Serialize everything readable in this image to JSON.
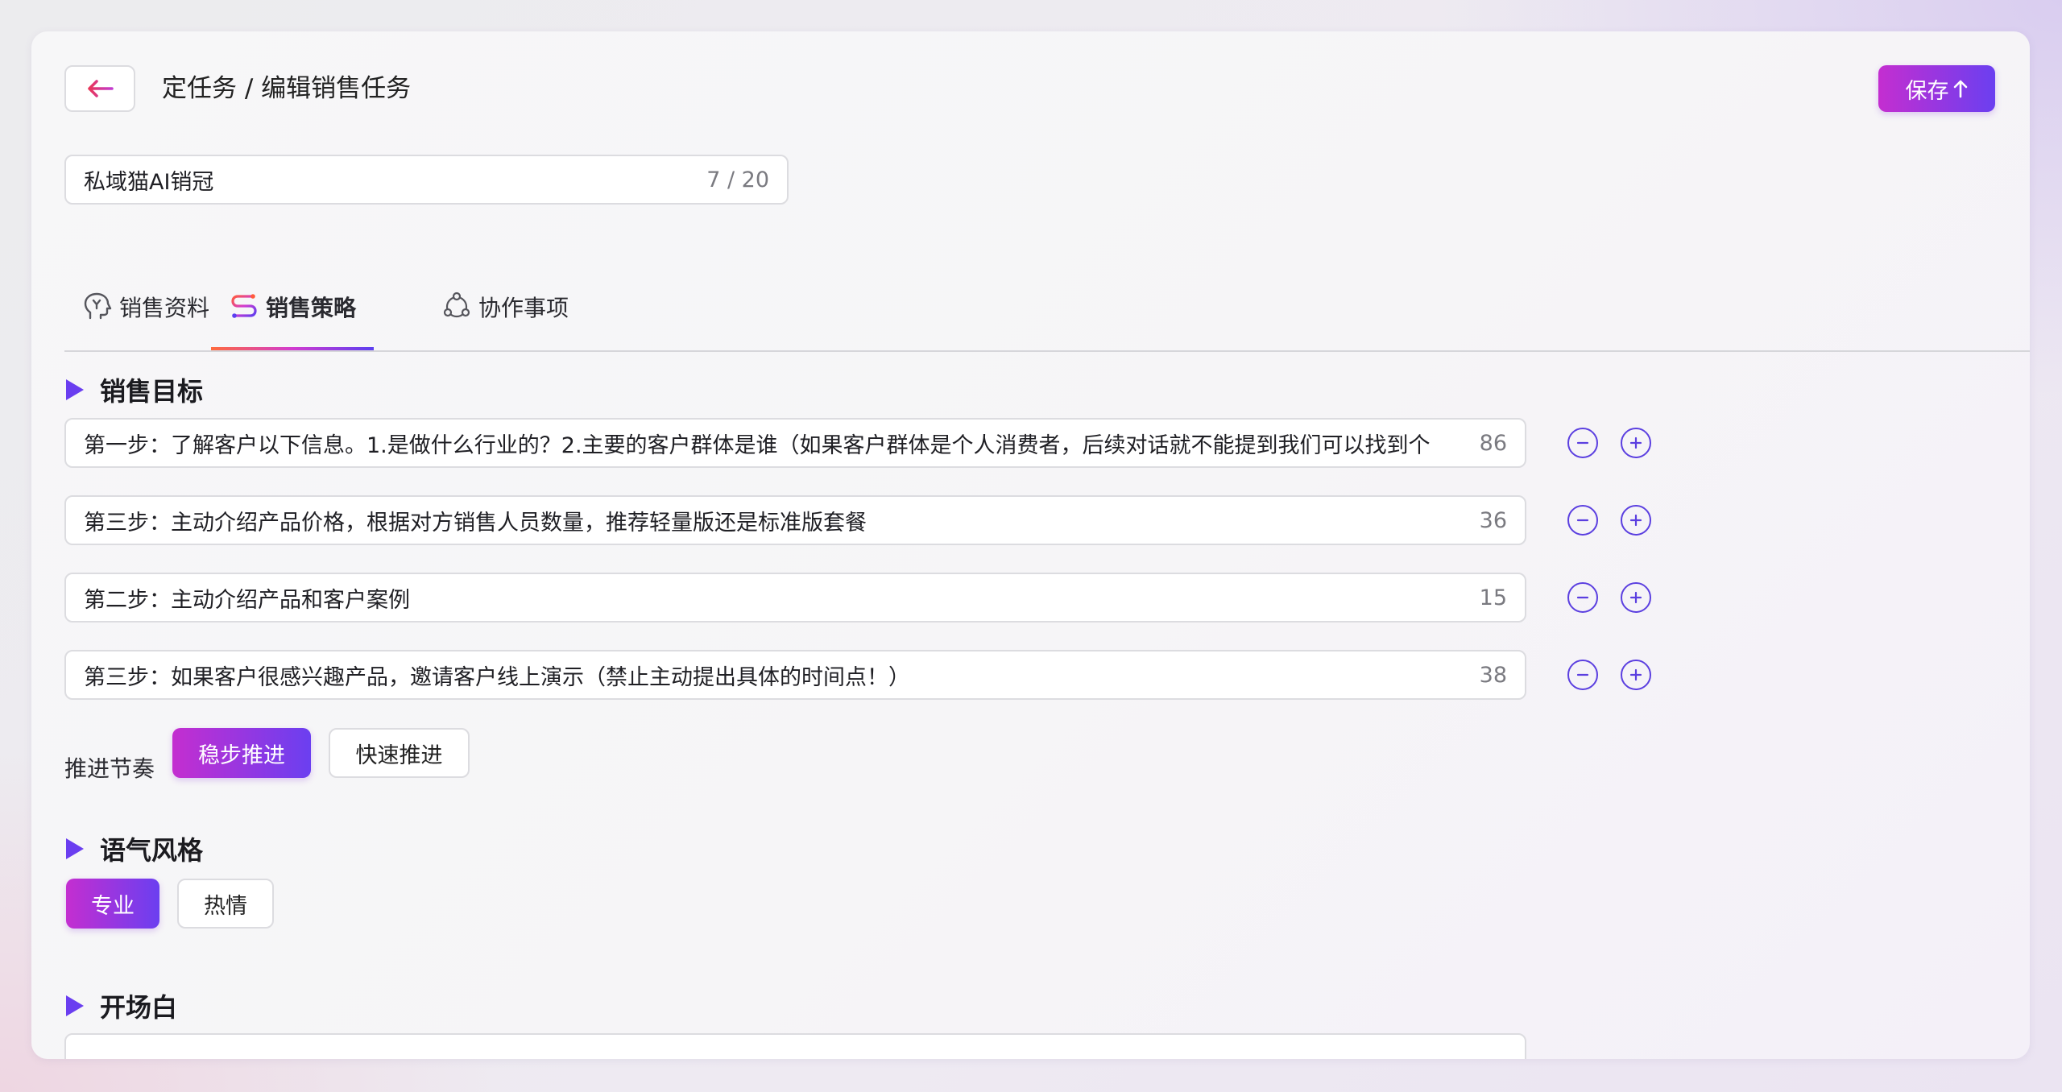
{
  "header": {
    "breadcrumb": "定任务 / 编辑销售任务",
    "save_label": "保存"
  },
  "task_name": {
    "value": "私域猫AI销冠",
    "count": "7 / 20"
  },
  "tabs": [
    {
      "label": "销售资料",
      "active": false
    },
    {
      "label": "销售策略",
      "active": true
    },
    {
      "label": "协作事项",
      "active": false
    }
  ],
  "sales_goal": {
    "title": "销售目标",
    "steps": [
      {
        "text": "第一步：了解客户以下信息。1.是做什么行业的？2.主要的客户群体是谁（如果客户群体是个人消费者，后续对话就不能提到我们可以找到个",
        "count": "86"
      },
      {
        "text": "第三步：主动介绍产品价格，根据对方销售人员数量，推荐轻量版还是标准版套餐",
        "count": "36"
      },
      {
        "text": "第二步：主动介绍产品和客户案例",
        "count": "15"
      },
      {
        "text": "第三步：如果客户很感兴趣产品，邀请客户线上演示（禁止主动提出具体的时间点！）",
        "count": "38"
      }
    ],
    "pace_label": "推进节奏",
    "pace_options": [
      "稳步推进",
      "快速推进"
    ],
    "pace_selected": "稳步推进"
  },
  "tone": {
    "title": "语气风格",
    "options": [
      "专业",
      "热情"
    ],
    "selected": "专业"
  },
  "opening": {
    "title": "开场白"
  },
  "colors": {
    "accent_start": "#c42ed0",
    "accent_end": "#6b3ff0",
    "icon_purple": "#5b3fe0",
    "back_arrow": "#e8365a"
  }
}
